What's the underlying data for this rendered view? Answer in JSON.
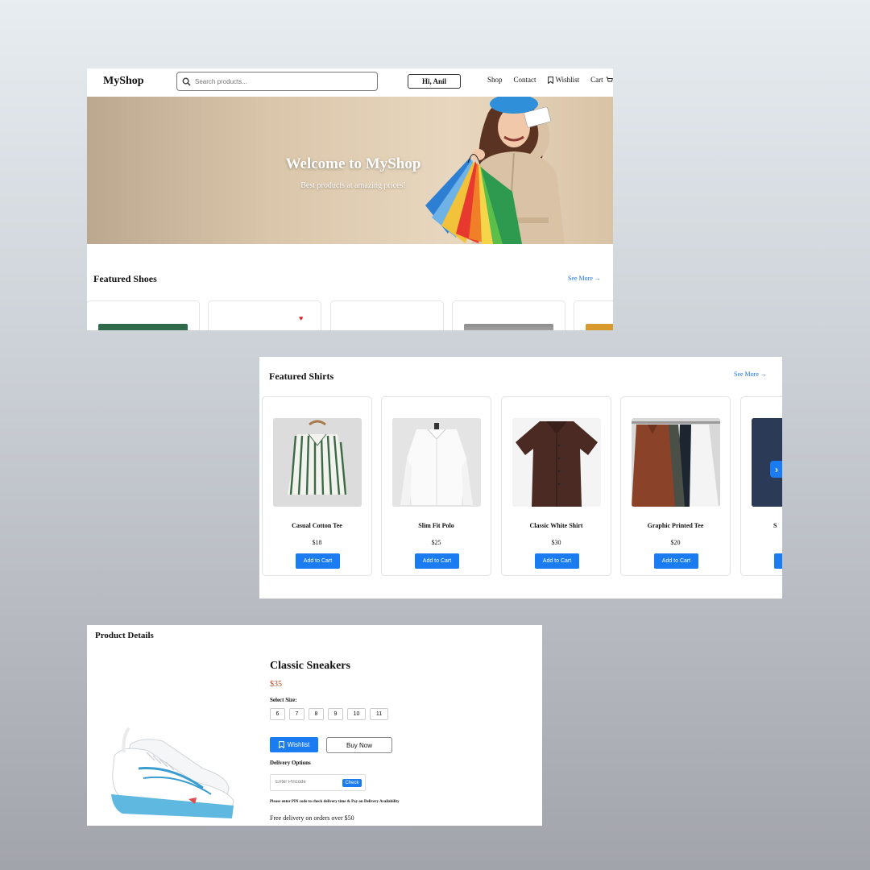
{
  "header": {
    "logo": "MyShop",
    "search_placeholder": "Search products...",
    "greeting": "Hi, Anil",
    "nav": {
      "shop": "Shop",
      "contact": "Contact",
      "wishlist": "Wishlist",
      "cart": "Cart"
    }
  },
  "hero": {
    "title": "Welcome to MyShop",
    "subtitle": "Best products at amazing prices!"
  },
  "featured_shoes": {
    "title": "Featured Shoes",
    "see_more": "See More →",
    "thumb_colors": [
      "#2f6a4a",
      "#ffffff",
      "#ffffff",
      "#a9a9a9",
      "#d89a2c"
    ],
    "heart": "♥"
  },
  "featured_shirts": {
    "title": "Featured Shirts",
    "see_more": "See More →",
    "next_arrow": "›",
    "products": [
      {
        "name": "Casual Cotton Tee",
        "price": "$18",
        "button": "Add to Cart"
      },
      {
        "name": "Slim Fit Polo",
        "price": "$25",
        "button": "Add to Cart"
      },
      {
        "name": "Classic White Shirt",
        "price": "$30",
        "button": "Add to Cart"
      },
      {
        "name": "Graphic Printed Tee",
        "price": "$20",
        "button": "Add to Cart"
      },
      {
        "name": "S",
        "price": "",
        "button": ""
      }
    ]
  },
  "product_details": {
    "heading": "Product Details",
    "name": "Classic Sneakers",
    "price": "$35",
    "size_label": "Select Size:",
    "sizes": [
      "6",
      "7",
      "8",
      "9",
      "10",
      "11"
    ],
    "wishlist_button": "Wishlist",
    "buy_button": "Buy Now",
    "delivery_label": "Delivery Options",
    "pincode_placeholder": "Enter Pincode",
    "check_button": "Check",
    "pin_note": "Please enter PIN code to check delivery time & Pay on Delivery Availability",
    "free_delivery": "Free delivery on orders over $50"
  },
  "colors": {
    "accent": "#1a7cf0",
    "link": "#1a73e8",
    "price": "#b3471d"
  }
}
